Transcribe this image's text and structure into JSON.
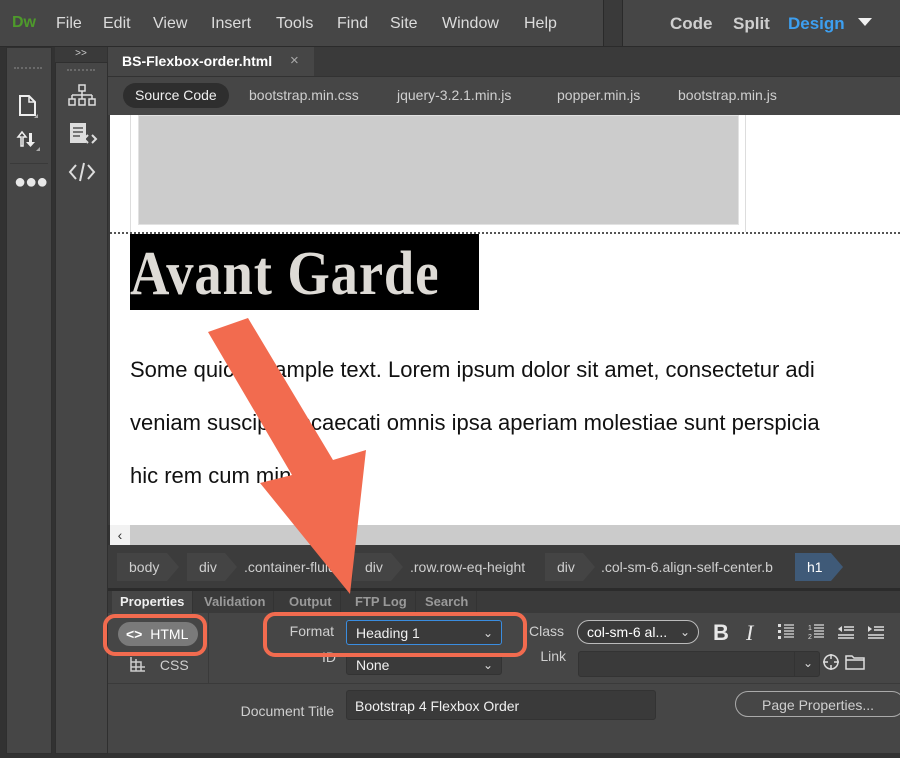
{
  "app": {
    "logo": "Dw",
    "menu": [
      "File",
      "Edit",
      "View",
      "Insert",
      "Tools",
      "Find",
      "Site",
      "Window",
      "Help"
    ],
    "views": {
      "code": "Code",
      "split": "Split",
      "design": "Design",
      "active": "Design"
    },
    "accent_color": "#3d9ff0"
  },
  "toolbar": {
    "collapse_label": ">>",
    "icons": [
      "new-file-icon",
      "file-transfer-icon",
      "more-icon",
      "dom-tree-icon",
      "code-navigator-icon",
      "code-view-icon"
    ]
  },
  "document": {
    "tab_label": "BS-Flexbox-order.html",
    "close_glyph": "×",
    "related_files": [
      "Source Code",
      "bootstrap.min.css",
      "jquery-3.2.1.min.js",
      "popper.min.js",
      "bootstrap.min.js"
    ],
    "active_related": "Source Code"
  },
  "design_view": {
    "heading": "Avant Garde",
    "paragraph_lines": [
      "Some quick example text. Lorem ipsum dolor sit amet, consectetur adi",
      "veniam suscipit obcaecati omnis ipsa aperiam molestiae sunt perspicia",
      "hic rem cum minus odit."
    ],
    "scroll_left_glyph": "‹"
  },
  "tag_selector": {
    "tags": [
      "body",
      "div",
      ".container-fluid",
      "div",
      ".row.row-eq-height",
      "div",
      ".col-sm-6.align-self-center.b",
      "h1"
    ],
    "selected": "h1"
  },
  "panel_tabs": [
    "Properties",
    "Validation",
    "Output",
    "FTP Log",
    "Search"
  ],
  "properties": {
    "html_button": "HTML",
    "css_button": "CSS",
    "format_label": "Format",
    "format_value": "Heading 1",
    "id_label": "ID",
    "id_value": "None",
    "class_label": "Class",
    "class_value": "col-sm-6 al...",
    "link_label": "Link",
    "link_value": "",
    "document_title_label": "Document Title",
    "document_title_value": "Bootstrap 4 Flexbox Order",
    "page_properties_button": "Page Properties...",
    "format_buttons": {
      "bold": "B",
      "italic": "I"
    }
  },
  "annotations": {
    "color": "#f26b4f",
    "highlighted": [
      "HTML button",
      "Format dropdown"
    ]
  }
}
